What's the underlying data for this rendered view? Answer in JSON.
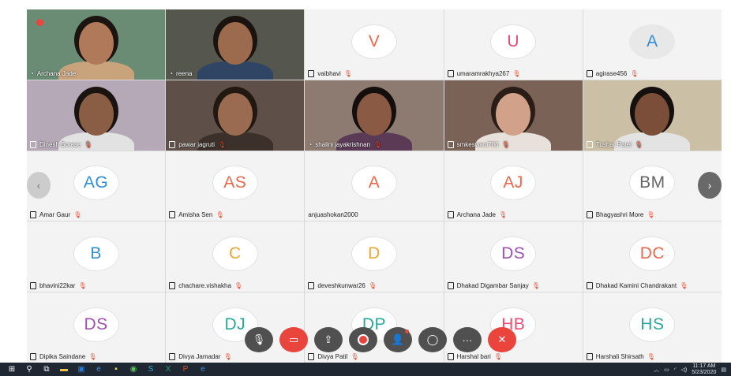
{
  "participants": [
    {
      "name": "Archana Jade",
      "type": "video",
      "bg": "#6b8c74",
      "skin": "#b07a5a",
      "hair": "#1c1410",
      "shirt": "#c9a37c",
      "speaking": true
    },
    {
      "name": "reena",
      "type": "video",
      "bg": "#55574f",
      "skin": "#9c6a4c",
      "hair": "#1a1310",
      "shirt": "#2f4563",
      "speaking": true
    },
    {
      "name": "vaibhavi",
      "type": "avatar",
      "initials": "V",
      "color": "#e86a4b"
    },
    {
      "name": "umaramrakhya267",
      "type": "avatar",
      "initials": "U",
      "color": "#e84b73"
    },
    {
      "name": "agirase456",
      "type": "avatar",
      "initials": "A",
      "color": "#2f8fd4",
      "filled": true
    },
    {
      "name": "Dinesh Borase",
      "type": "video",
      "bg": "#b6a9b7",
      "skin": "#8a5e44",
      "hair": "#1a1310",
      "shirt": "#e2e2e2"
    },
    {
      "name": "pawar jagruti",
      "type": "video",
      "bg": "#5e5048",
      "skin": "#9a6b50",
      "hair": "#221812",
      "shirt": "#3b302a"
    },
    {
      "name": "shalini jayakrishnan",
      "type": "video",
      "bg": "#8d7b71",
      "skin": "#8a5a44",
      "hair": "#140f0d",
      "shirt": "#5a3a55",
      "speaking": true
    },
    {
      "name": "smkeswani786",
      "type": "video",
      "bg": "#7b6256",
      "skin": "#d1a18a",
      "hair": "#2a1c16",
      "shirt": "#e8e0da"
    },
    {
      "name": "Tushar Patel",
      "type": "video",
      "bg": "#cbbfa6",
      "skin": "#7a4e38",
      "hair": "#15100e",
      "shirt": "#e3e3e3"
    },
    {
      "name": "Amar Gaur",
      "type": "avatar",
      "initials": "AG",
      "color": "#2f8fd4"
    },
    {
      "name": "Amisha Sen",
      "type": "avatar",
      "initials": "AS",
      "color": "#e86a4b"
    },
    {
      "name": "anjuashokan2000",
      "type": "avatar",
      "initials": "A",
      "color": "#e86a4b",
      "noicon": true
    },
    {
      "name": "Archana Jade",
      "type": "avatar",
      "initials": "AJ",
      "color": "#e86a4b"
    },
    {
      "name": "Bhagyashri More",
      "type": "avatar",
      "initials": "BM",
      "color": "#666666"
    },
    {
      "name": "bhavini22kar",
      "type": "avatar",
      "initials": "B",
      "color": "#2f8fd4"
    },
    {
      "name": "chachare.vishakha",
      "type": "avatar",
      "initials": "C",
      "color": "#eea636"
    },
    {
      "name": "deveshkunwar26",
      "type": "avatar",
      "initials": "D",
      "color": "#eea636"
    },
    {
      "name": "Dhakad Digambar Sanjay",
      "type": "avatar",
      "initials": "DS",
      "color": "#a04fb0"
    },
    {
      "name": "Dhakad Kamini Chandrakant",
      "type": "avatar",
      "initials": "DC",
      "color": "#e86a4b"
    },
    {
      "name": "Dipika Saindane",
      "type": "avatar",
      "initials": "DS",
      "color": "#a04fb0"
    },
    {
      "name": "Divya Jamadar",
      "type": "avatar",
      "initials": "DJ",
      "color": "#2aa79b"
    },
    {
      "name": "Divya Patil",
      "type": "avatar",
      "initials": "DP",
      "color": "#2aa79b"
    },
    {
      "name": "Harshal bari",
      "type": "avatar",
      "initials": "HB",
      "color": "#e84b73"
    },
    {
      "name": "Harshali Shirsath",
      "type": "avatar",
      "initials": "HS",
      "color": "#2aa79b"
    }
  ],
  "controls": [
    {
      "name": "mute-button",
      "icon": "mic-muted-icon",
      "glyph": "🎙",
      "style": "dark"
    },
    {
      "name": "video-button",
      "icon": "video-off-icon",
      "glyph": "▭",
      "style": "red"
    },
    {
      "name": "share-button",
      "icon": "share-icon",
      "glyph": "⇪",
      "style": "dark"
    },
    {
      "name": "record-button",
      "icon": "record-icon",
      "glyph": "",
      "style": "dark",
      "record": true
    },
    {
      "name": "participants-button",
      "icon": "participants-icon",
      "glyph": "👤",
      "style": "dark",
      "badge": true
    },
    {
      "name": "chat-button",
      "icon": "chat-icon",
      "glyph": "◯",
      "style": "dark"
    },
    {
      "name": "more-button",
      "icon": "more-icon",
      "glyph": "···",
      "style": "dark"
    },
    {
      "name": "leave-button",
      "icon": "close-icon",
      "glyph": "✕",
      "style": "red"
    }
  ],
  "taskbar": {
    "apps": [
      {
        "name": "start-icon",
        "glyph": "⊞",
        "color": "#ffffff"
      },
      {
        "name": "search-icon",
        "glyph": "⚲",
        "color": "#ffffff"
      },
      {
        "name": "task-view-icon",
        "glyph": "⧉",
        "color": "#ffffff"
      },
      {
        "name": "file-explorer-icon",
        "glyph": "▬",
        "color": "#f2c14e"
      },
      {
        "name": "outlook-icon",
        "glyph": "▣",
        "color": "#2b79d0"
      },
      {
        "name": "edge-icon",
        "glyph": "e",
        "color": "#3a8ee6"
      },
      {
        "name": "sticky-notes-icon",
        "glyph": "▪",
        "color": "#f2d94e"
      },
      {
        "name": "chrome-icon",
        "glyph": "◉",
        "color": "#5cc45c"
      },
      {
        "name": "skype-icon",
        "glyph": "S",
        "color": "#2aa8e0"
      },
      {
        "name": "excel-icon",
        "glyph": "X",
        "color": "#21a366"
      },
      {
        "name": "powerpoint-icon",
        "glyph": "P",
        "color": "#d35230"
      },
      {
        "name": "ie-icon",
        "glyph": "e",
        "color": "#3a8ee6"
      }
    ],
    "time": "11:17 AM",
    "date": "5/23/2020"
  }
}
